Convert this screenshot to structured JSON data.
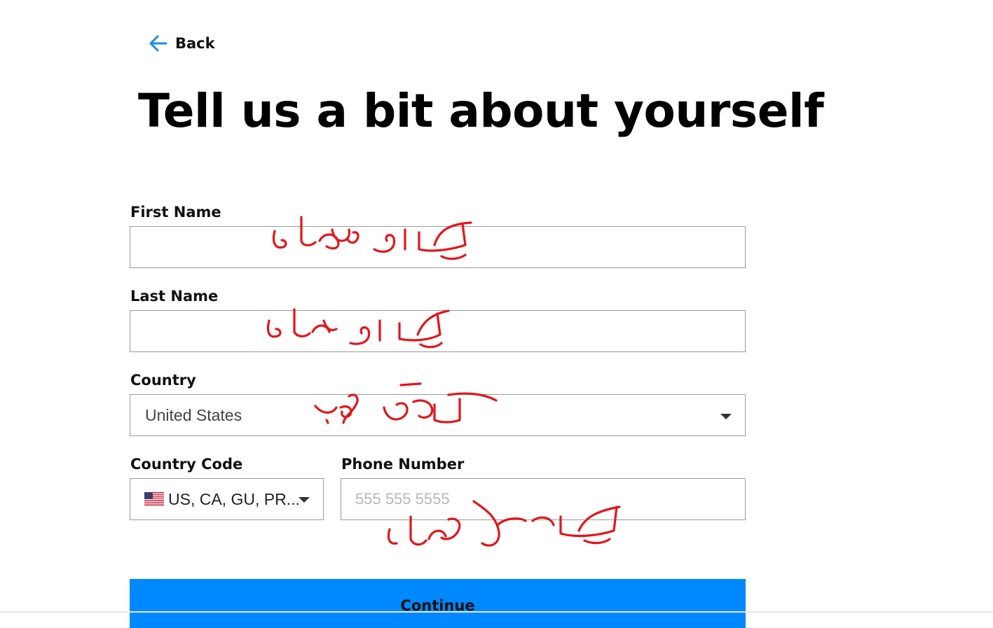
{
  "nav": {
    "back_label": "Back"
  },
  "page": {
    "title": "Tell us a bit about yourself"
  },
  "form": {
    "first_name": {
      "label": "First Name",
      "value": ""
    },
    "last_name": {
      "label": "Last Name",
      "value": ""
    },
    "country": {
      "label": "Country",
      "selected": "United States"
    },
    "country_code": {
      "label": "Country Code",
      "selected": "US, CA, GU, PR..."
    },
    "phone": {
      "label": "Phone Number",
      "placeholder": "555 555 5555",
      "value": ""
    },
    "continue_label": "Continue"
  },
  "colors": {
    "accent": "#0088ff",
    "annotation": "#e3151b",
    "border": "#9a9a9a"
  },
  "icons": {
    "back": "arrow-left-icon",
    "dropdown": "caret-down-icon",
    "flag": "us-flag-icon"
  },
  "annotations": {
    "first_name": "یک نام دلخواه",
    "last_name": "یک نام دلخواه",
    "country": "آمریکا خوبه",
    "phone": "یک شماره دلخواه"
  }
}
